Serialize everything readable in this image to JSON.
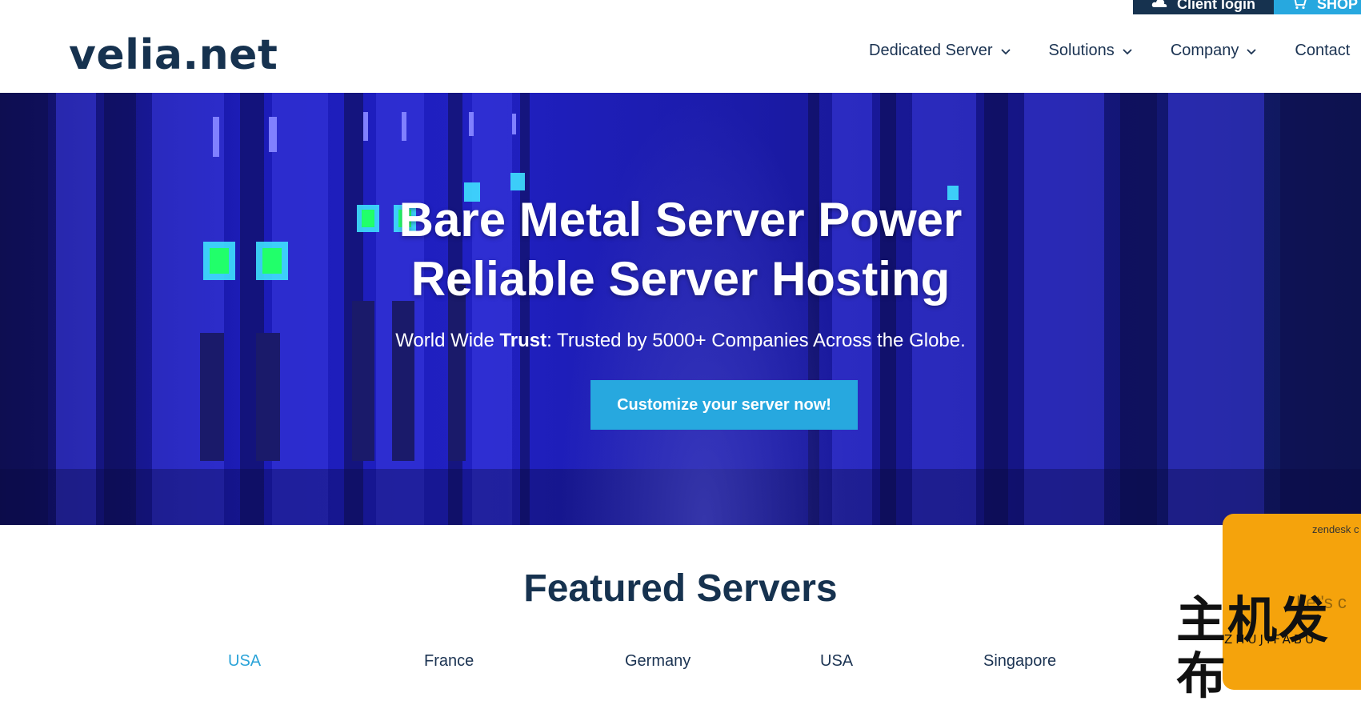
{
  "utility": {
    "client_login": "Client login",
    "shop": "SHOP"
  },
  "header": {
    "logo": "velia.net",
    "nav": [
      {
        "label": "Dedicated Server"
      },
      {
        "label": "Solutions"
      },
      {
        "label": "Company"
      },
      {
        "label": "Contact"
      }
    ]
  },
  "hero": {
    "title_line1": "Bare Metal Server Power",
    "title_line2": "Reliable Server Hosting",
    "subtitle_prefix": "World Wide ",
    "subtitle_bold": "Trust",
    "subtitle_rest": ": Trusted by 5000+ Companies Across the Globe.",
    "cta": "Customize your server now!"
  },
  "featured": {
    "title": "Featured Servers",
    "locations": [
      {
        "label": "USA",
        "active": true
      },
      {
        "label": "France",
        "active": false
      },
      {
        "label": "Germany",
        "active": false
      },
      {
        "label": "USA",
        "active": false
      },
      {
        "label": "Singapore",
        "active": false
      }
    ]
  },
  "widget": {
    "label": "zendesk c",
    "text": "Let's c"
  },
  "watermark": {
    "chinese": "主机发布",
    "latin": "ZHUJIFABU"
  },
  "colors": {
    "navy": "#16324f",
    "accent": "#27a8df",
    "hero_blue": "#2020c2",
    "widget_orange": "#f5a30c"
  }
}
